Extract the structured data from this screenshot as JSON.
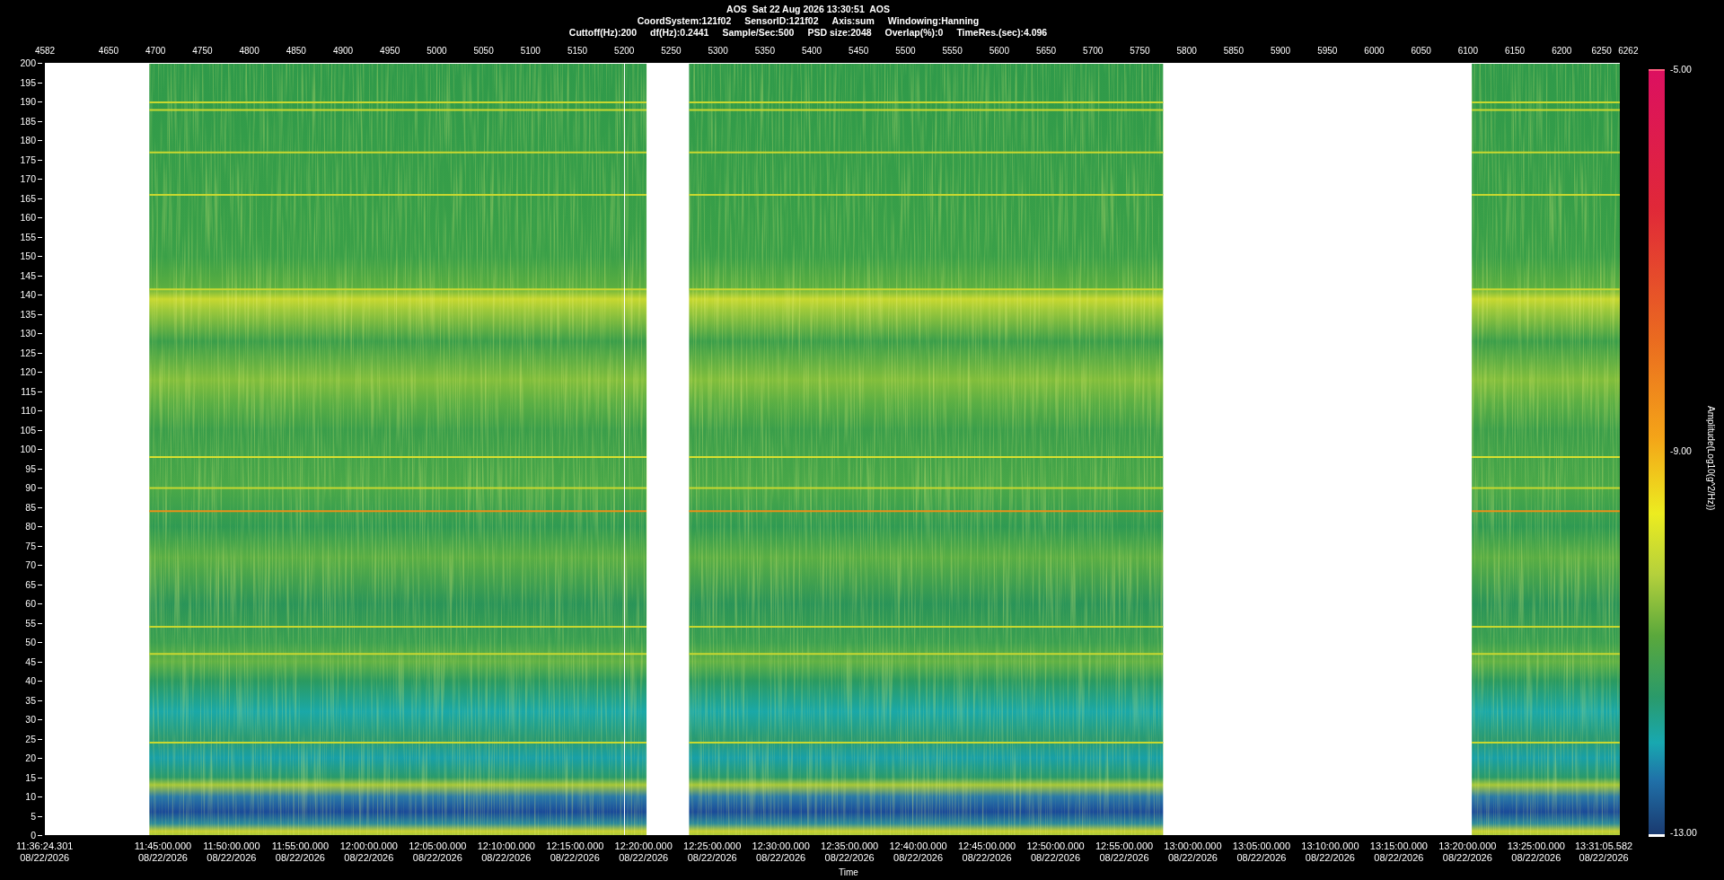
{
  "header": {
    "title": "AOS  Sat 22 Aug 2026 13:30:51  AOS",
    "settings_line_1": [
      "CoordSystem:121f02",
      "SensorID:121f02",
      "Axis:sum",
      "Windowing:Hanning"
    ],
    "settings_line_2": [
      "Cuttoff(Hz):200",
      "df(Hz):0.2441",
      "Sample/Sec:500",
      "PSD size:2048",
      "Overlap(%):0",
      "TimeRes.(sec):4.096"
    ]
  },
  "plot": {
    "top_axis_labels": [
      "4582",
      "4650",
      "4700",
      "4750",
      "4800",
      "4850",
      "4900",
      "4950",
      "5000",
      "5050",
      "5100",
      "5150",
      "5200",
      "5250",
      "5300",
      "5350",
      "5400",
      "5450",
      "5500",
      "5550",
      "5600",
      "5650",
      "5700",
      "5750",
      "5800",
      "5850",
      "5900",
      "5950",
      "6000",
      "6050",
      "6100",
      "6150",
      "6200",
      "6250",
      "6262"
    ],
    "y_axis_labels": [
      "200",
      "195",
      "190",
      "185",
      "180",
      "175",
      "170",
      "165",
      "160",
      "155",
      "150",
      "145",
      "140",
      "135",
      "130",
      "125",
      "120",
      "115",
      "110",
      "105",
      "100",
      "95",
      "90",
      "85",
      "80",
      "75",
      "70",
      "65",
      "60",
      "55",
      "50",
      "45",
      "40",
      "35",
      "30",
      "25",
      "20",
      "15",
      "10",
      "5",
      "0"
    ],
    "time_axis_labels": [
      {
        "time": "11:36:24.301",
        "date": "08/22/2026"
      },
      {
        "time": "11:45:00.000",
        "date": "08/22/2026"
      },
      {
        "time": "11:50:00.000",
        "date": "08/22/2026"
      },
      {
        "time": "11:55:00.000",
        "date": "08/22/2026"
      },
      {
        "time": "12:00:00.000",
        "date": "08/22/2026"
      },
      {
        "time": "12:05:00.000",
        "date": "08/22/2026"
      },
      {
        "time": "12:10:00.000",
        "date": "08/22/2026"
      },
      {
        "time": "12:15:00.000",
        "date": "08/22/2026"
      },
      {
        "time": "12:20:00.000",
        "date": "08/22/2026"
      },
      {
        "time": "12:25:00.000",
        "date": "08/22/2026"
      },
      {
        "time": "12:30:00.000",
        "date": "08/22/2026"
      },
      {
        "time": "12:35:00.000",
        "date": "08/22/2026"
      },
      {
        "time": "12:40:00.000",
        "date": "08/22/2026"
      },
      {
        "time": "12:45:00.000",
        "date": "08/22/2026"
      },
      {
        "time": "12:50:00.000",
        "date": "08/22/2026"
      },
      {
        "time": "12:55:00.000",
        "date": "08/22/2026"
      },
      {
        "time": "13:00:00.000",
        "date": "08/22/2026"
      },
      {
        "time": "13:05:00.000",
        "date": "08/22/2026"
      },
      {
        "time": "13:10:00.000",
        "date": "08/22/2026"
      },
      {
        "time": "13:15:00.000",
        "date": "08/22/2026"
      },
      {
        "time": "13:20:00.000",
        "date": "08/22/2026"
      },
      {
        "time": "13:25:00.000",
        "date": "08/22/2026"
      },
      {
        "time": "13:31:05.582",
        "date": "08/22/2026"
      }
    ],
    "xlabel": "Time",
    "colorbar": {
      "max": "-5.00",
      "mid": "-9.00",
      "min": "-13.00",
      "label": "Amplitude(Log10(g^2/Hz))"
    }
  }
}
